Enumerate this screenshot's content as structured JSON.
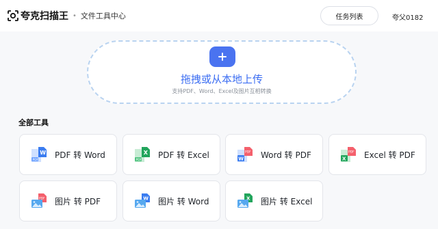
{
  "header": {
    "logo_text": "夸克扫描王",
    "separator": "•",
    "subtitle": "文件工具中心",
    "tasks_button": "任务列表",
    "username": "夸父0182"
  },
  "upload": {
    "title": "拖拽或从本地上传",
    "hint": "支持PDF、Word、Excel及图片互相转换"
  },
  "tools": {
    "section_title": "全部工具",
    "items": [
      {
        "label": "PDF 转 Word",
        "from": "pdf",
        "to": "word"
      },
      {
        "label": "PDF 转 Excel",
        "from": "pdf",
        "to": "excel"
      },
      {
        "label": "Word 转 PDF",
        "from": "word",
        "to": "pdf"
      },
      {
        "label": "Excel 转 PDF",
        "from": "excel",
        "to": "pdf"
      },
      {
        "label": "图片 转 PDF",
        "from": "image",
        "to": "pdf"
      },
      {
        "label": "图片 转 Word",
        "from": "image",
        "to": "word"
      },
      {
        "label": "图片 转 Excel",
        "from": "image",
        "to": "excel"
      }
    ]
  },
  "colors": {
    "accent": "#3b6df2",
    "plus_button": "#4a73f0",
    "upload_border": "#b9d3f0",
    "pdf": "#f4606c",
    "word": "#3a7cf0",
    "excel": "#22a55c"
  }
}
